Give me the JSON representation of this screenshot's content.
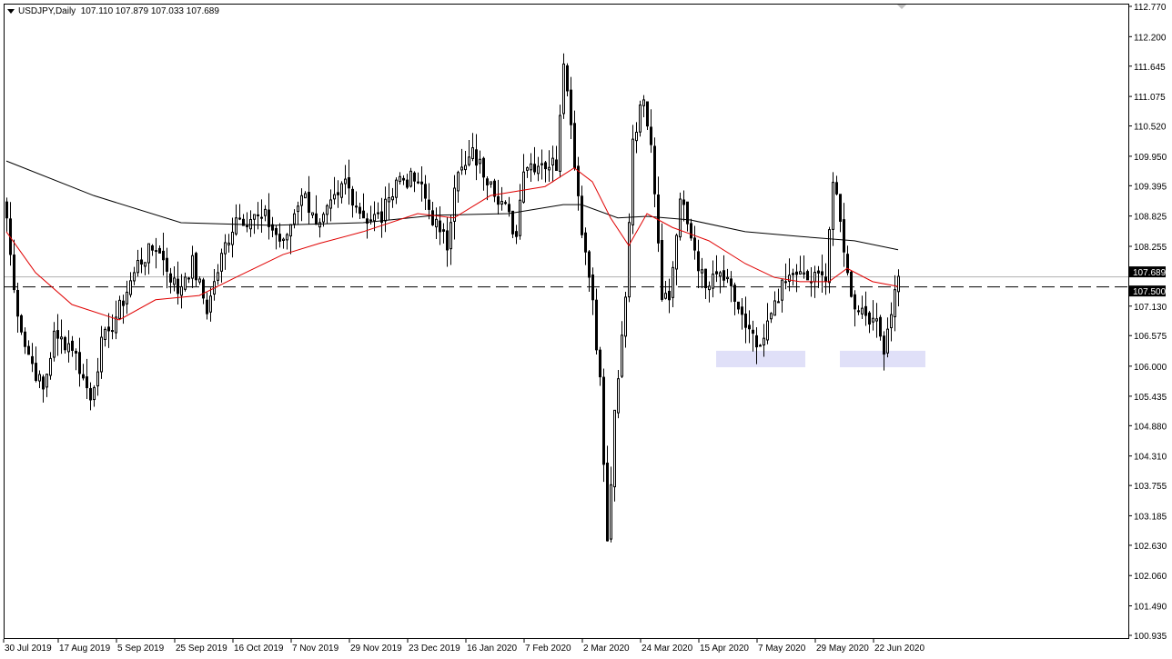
{
  "header": {
    "symbol": "USDJPY,Daily",
    "ohlc": "107.110 107.879 107.033 107.689"
  },
  "chart_data": {
    "type": "candlestick",
    "title": "USDJPY,Daily",
    "ylim": [
      100.935,
      112.77
    ],
    "y_ticks": [
      "112.770",
      "112.200",
      "111.645",
      "111.075",
      "110.520",
      "109.950",
      "109.395",
      "108.825",
      "108.255",
      "107.130",
      "106.575",
      "106.000",
      "105.435",
      "104.880",
      "104.310",
      "103.755",
      "103.185",
      "102.630",
      "102.060",
      "101.490",
      "100.935"
    ],
    "x_ticks": [
      {
        "bar": 0,
        "label": "30 Jul 2019"
      },
      {
        "bar": 15,
        "label": "17 Aug 2019"
      },
      {
        "bar": 31,
        "label": "5 Sep 2019"
      },
      {
        "bar": 47,
        "label": "25 Sep 2019"
      },
      {
        "bar": 63,
        "label": "16 Oct 2019"
      },
      {
        "bar": 79,
        "label": "7 Nov 2019"
      },
      {
        "bar": 95,
        "label": "29 Nov 2019"
      },
      {
        "bar": 111,
        "label": "23 Dec 2019"
      },
      {
        "bar": 127,
        "label": "16 Jan 2020"
      },
      {
        "bar": 143,
        "label": "7 Feb 2020"
      },
      {
        "bar": 159,
        "label": "2 Mar 2020"
      },
      {
        "bar": 175,
        "label": "24 Mar 2020"
      },
      {
        "bar": 191,
        "label": "15 Apr 2020"
      },
      {
        "bar": 207,
        "label": "7 May 2020"
      },
      {
        "bar": 223,
        "label": "29 May 2020"
      },
      {
        "bar": 239,
        "label": "22 Jun 2020"
      }
    ],
    "close_anchors": [
      [
        0,
        108.79
      ],
      [
        2,
        107.42
      ],
      [
        5,
        106.39
      ],
      [
        10,
        105.54
      ],
      [
        13,
        106.56
      ],
      [
        18,
        106.39
      ],
      [
        23,
        105.37
      ],
      [
        26,
        106.39
      ],
      [
        31,
        107.08
      ],
      [
        36,
        107.93
      ],
      [
        41,
        108.27
      ],
      [
        47,
        107.42
      ],
      [
        51,
        107.93
      ],
      [
        55,
        107.08
      ],
      [
        60,
        108.27
      ],
      [
        63,
        108.79
      ],
      [
        71,
        108.79
      ],
      [
        76,
        108.27
      ],
      [
        81,
        109.3
      ],
      [
        86,
        108.61
      ],
      [
        93,
        109.47
      ],
      [
        98,
        108.79
      ],
      [
        103,
        108.79
      ],
      [
        107,
        109.55
      ],
      [
        113,
        109.47
      ],
      [
        117,
        108.79
      ],
      [
        121,
        108.27
      ],
      [
        123,
        109.47
      ],
      [
        128,
        109.98
      ],
      [
        133,
        109.47
      ],
      [
        137,
        108.96
      ],
      [
        140,
        108.44
      ],
      [
        142,
        109.81
      ],
      [
        147,
        109.81
      ],
      [
        151,
        109.81
      ],
      [
        153,
        111.86
      ],
      [
        155,
        110.5
      ],
      [
        158,
        108.61
      ],
      [
        161,
        107.25
      ],
      [
        163,
        105.71
      ],
      [
        165,
        102.63
      ],
      [
        167,
        105.02
      ],
      [
        170,
        107.25
      ],
      [
        172,
        110.32
      ],
      [
        175,
        111.01
      ],
      [
        177,
        110.32
      ],
      [
        180,
        107.42
      ],
      [
        182,
        107.25
      ],
      [
        185,
        109.13
      ],
      [
        188,
        108.44
      ],
      [
        192,
        107.42
      ],
      [
        196,
        107.76
      ],
      [
        200,
        107.25
      ],
      [
        203,
        106.73
      ],
      [
        207,
        106.22
      ],
      [
        211,
        107.25
      ],
      [
        216,
        107.76
      ],
      [
        221,
        107.59
      ],
      [
        225,
        107.76
      ],
      [
        227,
        109.47
      ],
      [
        230,
        108.27
      ],
      [
        232,
        107.25
      ],
      [
        235,
        107.08
      ],
      [
        238,
        106.9
      ],
      [
        241,
        106.39
      ],
      [
        243,
        107.08
      ],
      [
        245,
        107.689
      ]
    ],
    "ma_slow": {
      "color": "#000000",
      "points": [
        [
          0,
          109.86
        ],
        [
          24,
          109.21
        ],
        [
          48,
          108.7
        ],
        [
          73,
          108.65
        ],
        [
          98,
          108.7
        ],
        [
          118,
          108.84
        ],
        [
          138,
          108.87
        ],
        [
          153,
          109.04
        ],
        [
          158,
          109.04
        ],
        [
          168,
          108.79
        ],
        [
          176,
          108.82
        ],
        [
          188,
          108.75
        ],
        [
          203,
          108.53
        ],
        [
          218,
          108.44
        ],
        [
          233,
          108.36
        ],
        [
          245,
          108.19
        ]
      ]
    },
    "ma_fast": {
      "color": "#e00000",
      "points": [
        [
          0,
          108.53
        ],
        [
          8,
          107.76
        ],
        [
          18,
          107.16
        ],
        [
          31,
          106.87
        ],
        [
          41,
          107.25
        ],
        [
          53,
          107.33
        ],
        [
          63,
          107.67
        ],
        [
          76,
          108.1
        ],
        [
          86,
          108.31
        ],
        [
          98,
          108.53
        ],
        [
          113,
          108.87
        ],
        [
          123,
          108.79
        ],
        [
          133,
          109.21
        ],
        [
          148,
          109.38
        ],
        [
          156,
          109.73
        ],
        [
          161,
          109.47
        ],
        [
          166,
          108.79
        ],
        [
          171,
          108.27
        ],
        [
          176,
          108.87
        ],
        [
          183,
          108.61
        ],
        [
          193,
          108.36
        ],
        [
          203,
          107.93
        ],
        [
          211,
          107.67
        ],
        [
          218,
          107.59
        ],
        [
          226,
          107.59
        ],
        [
          231,
          107.84
        ],
        [
          238,
          107.59
        ],
        [
          245,
          107.5
        ]
      ]
    },
    "zones": [
      {
        "from_bar": 195,
        "to_bar": 219.5,
        "low": 105.98,
        "high": 106.29,
        "color": "#e0e0f8"
      },
      {
        "from_bar": 229,
        "to_bar": 252.5,
        "low": 105.98,
        "high": 106.29,
        "color": "#e0e0f8"
      }
    ],
    "levels": [
      {
        "price": 107.689,
        "label": "107.689",
        "style": "solid"
      },
      {
        "price": 107.5,
        "label": "107.500",
        "style": "dashed"
      }
    ]
  }
}
